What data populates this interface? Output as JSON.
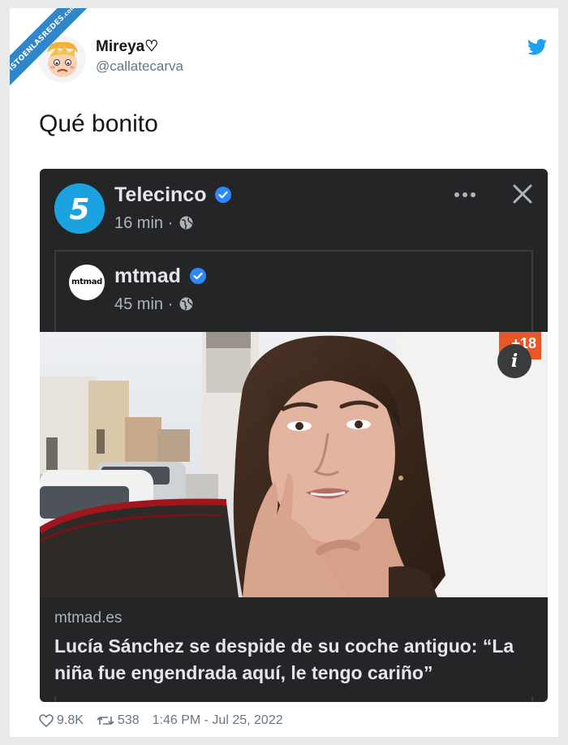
{
  "watermark": {
    "text": "VISTOENLASREDES",
    "suffix": ".com"
  },
  "tweet": {
    "user_name": "Mireya♡",
    "user_handle": "@callatecarva",
    "text": "Qué bonito",
    "likes": "9.8K",
    "retweets": "538",
    "timestamp": "1:46 PM - Jul 25, 2022"
  },
  "embed": {
    "page_name": "Telecinco",
    "page_time": "16 min ·",
    "page_logo": "5",
    "shared_name": "mtmad",
    "shared_logo_text": "mtmad",
    "shared_time": "45 min ·",
    "age_badge": "+18",
    "info_icon": "i",
    "link_domain": "mtmad.es",
    "link_title": "Lucía Sánchez se despide de su coche antiguo: “La niña fue engendrada aquí, le tengo cariño”"
  },
  "colors": {
    "twitter_blue": "#1da1f2",
    "verified_blue": "#2d88ff",
    "dark_bg": "#242526",
    "telecinco_blue": "#1aa3e0"
  },
  "icons": [
    "twitter-bird-icon",
    "verified-icon",
    "globe-icon",
    "more-icon",
    "close-icon",
    "info-icon",
    "heart-icon",
    "retweet-icon"
  ]
}
